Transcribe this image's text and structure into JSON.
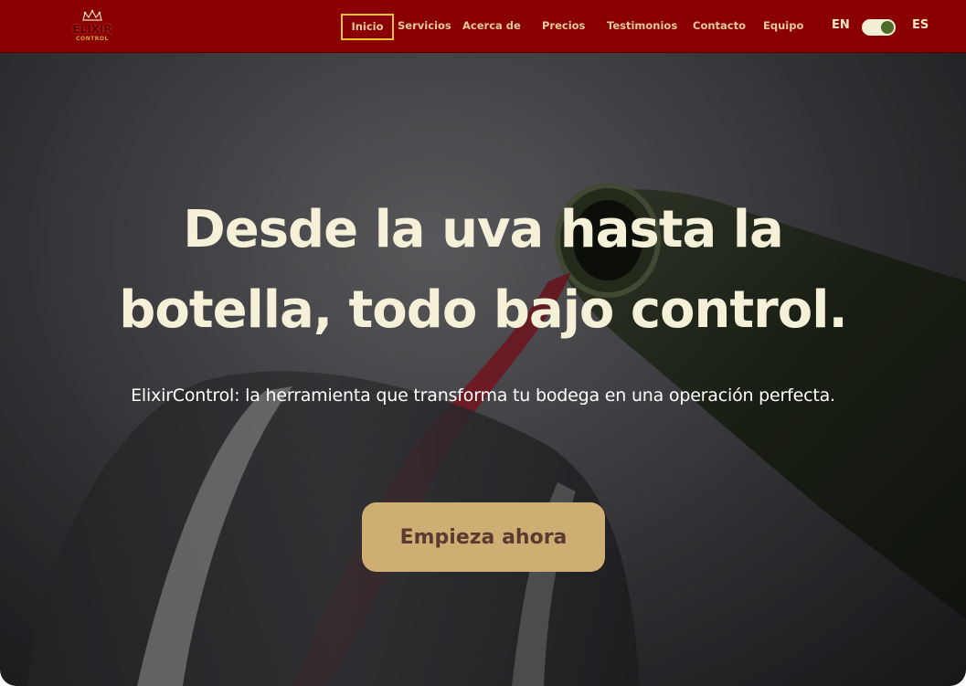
{
  "brand": {
    "logo_text": "ELIXIR",
    "logo_subtext": "CONTROL"
  },
  "nav": {
    "items": [
      {
        "label": "Inicio",
        "active": true
      },
      {
        "label": "Servicios"
      },
      {
        "label": "Acerca de"
      },
      {
        "label": "Precios"
      },
      {
        "label": "Testimonios"
      },
      {
        "label": "Contacto"
      },
      {
        "label": "Equipo"
      }
    ],
    "lang_left": "EN",
    "lang_right": "ES",
    "selected_language": "ES",
    "active_outline_color": "#f3c427"
  },
  "hero": {
    "title_line1": "Desde la uva hasta la",
    "title_line2": "botella, todo bajo control.",
    "subtitle": "ElixirControl: la herramienta que transforma tu bodega en una operación perfecta.",
    "cta_label": "Empieza ahora"
  },
  "colors": {
    "navbar": "#8a0000",
    "nav_text": "#e9c99a",
    "title_text": "#f5f1d9",
    "cta_background": "#cfae74",
    "cta_text": "#5b3a32",
    "toggle_knob": "#4f6b2a"
  }
}
